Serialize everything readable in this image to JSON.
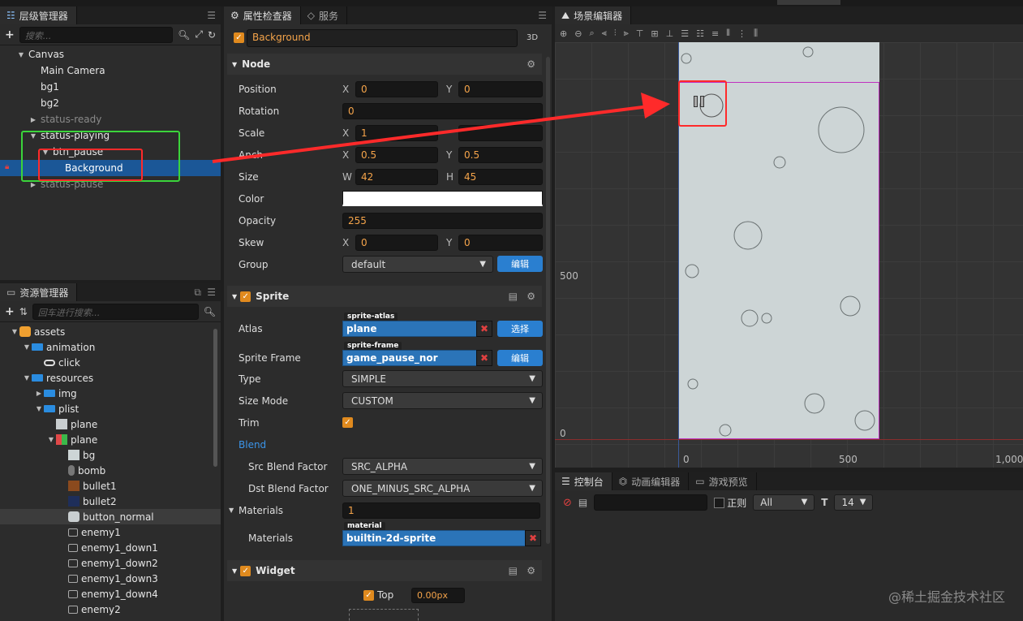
{
  "hierarchy": {
    "tab_title": "层级管理器",
    "search_placeholder": "搜索...",
    "items": [
      {
        "label": "Canvas",
        "depth": 0,
        "arrow": "▼",
        "style": ""
      },
      {
        "label": "Main Camera",
        "depth": 1,
        "arrow": "",
        "style": ""
      },
      {
        "label": "bg1",
        "depth": 1,
        "arrow": "",
        "style": ""
      },
      {
        "label": "bg2",
        "depth": 1,
        "arrow": "",
        "style": ""
      },
      {
        "label": "status-ready",
        "depth": 1,
        "arrow": "▶",
        "style": "dim"
      },
      {
        "label": "status-playing",
        "depth": 1,
        "arrow": "▼",
        "style": ""
      },
      {
        "label": "btn_pause",
        "depth": 2,
        "arrow": "▼",
        "style": ""
      },
      {
        "label": "Background",
        "depth": 3,
        "arrow": "",
        "style": "sel"
      },
      {
        "label": "status-pause",
        "depth": 1,
        "arrow": "▶",
        "style": "dim"
      }
    ]
  },
  "assets": {
    "tab_title": "资源管理器",
    "search_placeholder": "回车进行搜索...",
    "items": [
      {
        "label": "assets",
        "depth": 0,
        "arrow": "▼",
        "icon": "db"
      },
      {
        "label": "animation",
        "depth": 1,
        "arrow": "▼",
        "icon": "folder"
      },
      {
        "label": "click",
        "depth": 2,
        "arrow": "",
        "icon": "anim"
      },
      {
        "label": "resources",
        "depth": 1,
        "arrow": "▼",
        "icon": "folder"
      },
      {
        "label": "img",
        "depth": 2,
        "arrow": "▶",
        "icon": "folder"
      },
      {
        "label": "plist",
        "depth": 2,
        "arrow": "▼",
        "icon": "folder"
      },
      {
        "label": "plane",
        "depth": 3,
        "arrow": "",
        "icon": "plist"
      },
      {
        "label": "plane",
        "depth": 3,
        "arrow": "▼",
        "icon": "atlas"
      },
      {
        "label": "bg",
        "depth": 4,
        "arrow": "",
        "icon": "bg"
      },
      {
        "label": "bomb",
        "depth": 4,
        "arrow": "",
        "icon": "bomb"
      },
      {
        "label": "bullet1",
        "depth": 4,
        "arrow": "",
        "icon": "bullet1"
      },
      {
        "label": "bullet2",
        "depth": 4,
        "arrow": "",
        "icon": "bullet2"
      },
      {
        "label": "button_normal",
        "depth": 4,
        "arrow": "",
        "icon": "button"
      },
      {
        "label": "enemy1",
        "depth": 4,
        "arrow": "",
        "icon": "enemy"
      },
      {
        "label": "enemy1_down1",
        "depth": 4,
        "arrow": "",
        "icon": "enemy"
      },
      {
        "label": "enemy1_down2",
        "depth": 4,
        "arrow": "",
        "icon": "enemy"
      },
      {
        "label": "enemy1_down3",
        "depth": 4,
        "arrow": "",
        "icon": "enemy"
      },
      {
        "label": "enemy1_down4",
        "depth": 4,
        "arrow": "",
        "icon": "enemy"
      },
      {
        "label": "enemy2",
        "depth": 4,
        "arrow": "",
        "icon": "enemy"
      }
    ]
  },
  "inspector": {
    "tab_title": "属性检查器",
    "tab2_title": "服务",
    "node_name": "Background",
    "mode_3d": "3D",
    "node_section": "Node",
    "position": {
      "label": "Position",
      "x_label": "X",
      "x": "0",
      "y_label": "Y",
      "y": "0"
    },
    "rotation": {
      "label": "Rotation",
      "value": "0"
    },
    "scale": {
      "label": "Scale",
      "x_label": "X",
      "x": "1"
    },
    "anchor": {
      "label": "Anch",
      "x_label": "X",
      "x": "0.5",
      "y_label": "Y",
      "y": "0.5"
    },
    "size": {
      "label": "Size",
      "w_label": "W",
      "w": "42",
      "h_label": "H",
      "h": "45"
    },
    "color": {
      "label": "Color",
      "value": "#ffffff"
    },
    "opacity": {
      "label": "Opacity",
      "value": "255"
    },
    "skew": {
      "label": "Skew",
      "x_label": "X",
      "x": "0",
      "y_label": "Y",
      "y": "0"
    },
    "group": {
      "label": "Group",
      "value": "default",
      "edit": "编辑"
    },
    "sprite_section": "Sprite",
    "atlas": {
      "label": "Atlas",
      "tag": "sprite-atlas",
      "value": "plane",
      "btn": "选择"
    },
    "sprite_frame": {
      "label": "Sprite Frame",
      "tag": "sprite-frame",
      "value": "game_pause_nor",
      "btn": "编辑"
    },
    "type": {
      "label": "Type",
      "value": "SIMPLE"
    },
    "size_mode": {
      "label": "Size Mode",
      "value": "CUSTOM"
    },
    "trim": {
      "label": "Trim"
    },
    "blend": "Blend",
    "src_blend": {
      "label": "Src Blend Factor",
      "value": "SRC_ALPHA"
    },
    "dst_blend": {
      "label": "Dst Blend Factor",
      "value": "ONE_MINUS_SRC_ALPHA"
    },
    "materials_count": {
      "label": "Materials",
      "value": "1"
    },
    "materials": {
      "label": "Materials",
      "tag": "material",
      "value": "builtin-2d-sprite"
    },
    "widget_section": "Widget",
    "widget_top": {
      "label": "Top",
      "value": "0.00px"
    }
  },
  "scene": {
    "tab_title": "场景编辑器",
    "y_label_500": "500",
    "y_label_0": "0",
    "x_label_0": "0",
    "x_label_500": "500",
    "x_label_1000": "1,000"
  },
  "console": {
    "tab_title": "控制台",
    "tab2_title": "动画编辑器",
    "tab3_title": "游戏预览",
    "regex_label": "正则",
    "level": "All",
    "font_size": "14"
  },
  "watermark": "@稀土掘金技术社区",
  "colors": {
    "accent": "#e08a1e",
    "selection": "#1b5797",
    "blue_btn": "#2a7fd0",
    "annotation_red": "#ff2a2a",
    "annotation_green": "#3bd43b",
    "canvas_bg": "#cdd5d6"
  }
}
